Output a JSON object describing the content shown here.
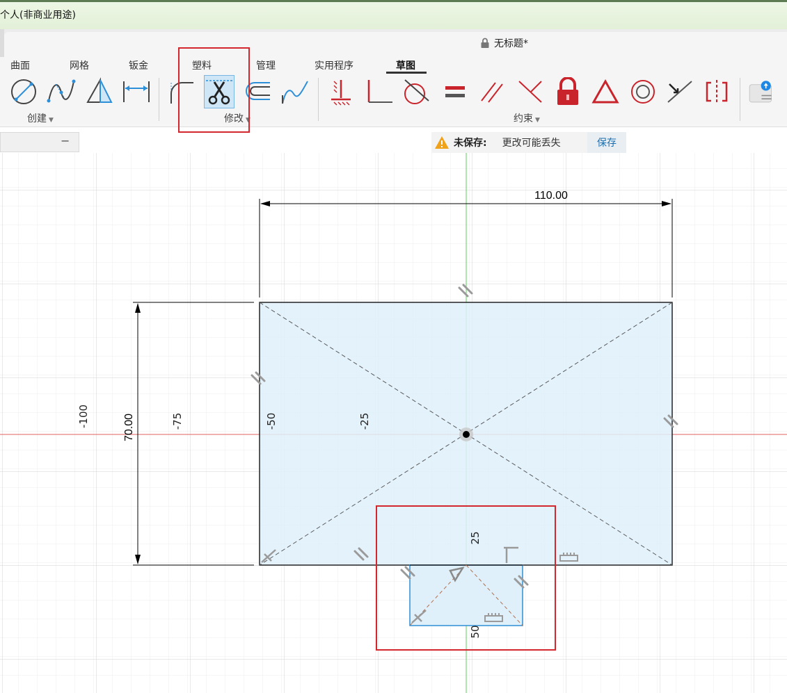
{
  "window": {
    "title": "个人(非商业用途)"
  },
  "document": {
    "title": "无标题*",
    "lock_icon": "lock-icon"
  },
  "tabs": [
    {
      "label": "曲面"
    },
    {
      "label": "网格"
    },
    {
      "label": "钣金"
    },
    {
      "label": "塑料"
    },
    {
      "label": "管理"
    },
    {
      "label": "实用程序"
    },
    {
      "label": "草图",
      "active": true
    }
  ],
  "toolbar": {
    "groups": {
      "create": "创建",
      "modify": "修改",
      "constraints": "约束"
    },
    "create_tools": [
      "circle-tool-icon",
      "spline-tool-icon",
      "triangle-tool-icon",
      "dimension-tool-icon"
    ],
    "modify_tools": [
      "fillet-tool-icon",
      "trim-scissors-icon",
      "offset-tool-icon",
      "extend-curve-icon"
    ],
    "constraint_tools": [
      "horizontal-vertical-icon",
      "coincident-icon",
      "tangent-icon",
      "equal-icon",
      "parallel-icon",
      "perpendicular-icon",
      "fix-lock-icon",
      "midpoint-triangle-icon",
      "concentric-icon",
      "collinear-icon",
      "symmetry-icon"
    ],
    "selected_tool": "trim-scissors-icon"
  },
  "notice": {
    "label": "未保存:",
    "message": "更改可能丢失",
    "action": "保存"
  },
  "sketch": {
    "dimensions": {
      "width": "110.00",
      "height": "70.00"
    },
    "axis_labels": [
      "-100",
      "-75",
      "-50",
      "-25",
      "25",
      "50"
    ],
    "colors": {
      "shape_fill": "#dff0fa",
      "x_axis": "#e26060",
      "y_axis": "#5ccf5c",
      "highlight_box": "#d4262d",
      "small_rect": "#2f8fd6"
    }
  }
}
